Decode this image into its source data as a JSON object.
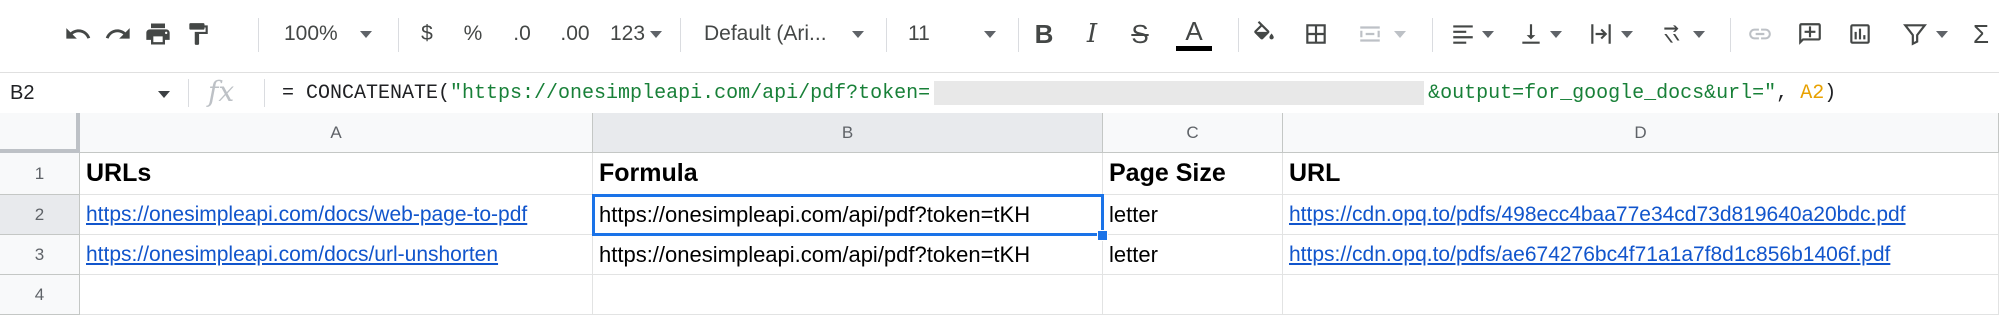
{
  "toolbar": {
    "zoom": "100%",
    "currency": "$",
    "percent": "%",
    "dec_decrease": ".0",
    "dec_increase": ".00",
    "number_format": "123",
    "font_family": "Default (Ari...",
    "font_size": "11",
    "icons": [
      "undo-icon",
      "redo-icon",
      "print-icon",
      "paint-format-icon",
      "bold-icon",
      "italic-icon",
      "strikethrough-icon",
      "text-color-icon",
      "fill-color-icon",
      "borders-icon",
      "merge-cells-icon",
      "align-left-icon",
      "valign-bottom-icon",
      "text-wrap-icon",
      "text-rotate-icon",
      "link-icon",
      "comment-icon",
      "chart-icon",
      "filter-icon",
      "functions-icon"
    ],
    "bold_label": "B",
    "italic_label": "I",
    "strike_label": "S",
    "textcolor_label": "A",
    "functions_label": "Σ"
  },
  "formula_bar": {
    "name_box": "B2",
    "fx_label": "fx",
    "formula_prefix": "= CONCATENATE(",
    "formula_string1": "\"https://onesimpleapi.com/api/pdf?token=",
    "formula_string2": "&output=for_google_docs&url=\"",
    "formula_comma": ", ",
    "formula_ref": "A2",
    "formula_suffix": ")"
  },
  "grid": {
    "columns": [
      "A",
      "B",
      "C",
      "D"
    ],
    "rows": [
      "1",
      "2",
      "3",
      "4"
    ],
    "selected_cell": "B2",
    "cells": {
      "A1": "URLs",
      "B1": "Formula",
      "C1": "Page Size",
      "D1": "URL",
      "A2": "https://onesimpleapi.com/docs/web-page-to-pdf",
      "B2": "https://onesimpleapi.com/api/pdf?token=tKH",
      "C2": "letter",
      "D2": "https://cdn.opq.to/pdfs/498ecc4baa77e34cd73d819640a20bdc.pdf",
      "A3": "https://onesimpleapi.com/docs/url-unshorten",
      "B3": "https://onesimpleapi.com/api/pdf?token=tKH",
      "C3": "letter",
      "D3": "https://cdn.opq.to/pdfs/ae674276bc4f71a1a7f8d1c856b1406f.pdf"
    }
  },
  "colors": {
    "selection": "#1a73e8",
    "link": "#1155cc",
    "formula_string": "#188038",
    "formula_ref": "#e8a100"
  }
}
